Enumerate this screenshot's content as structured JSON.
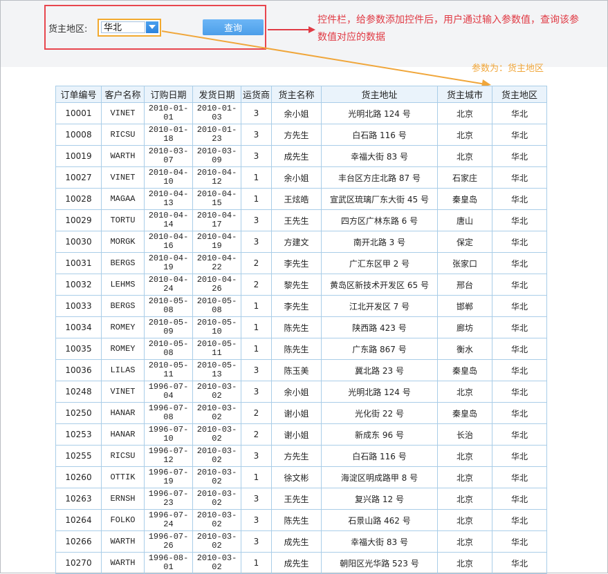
{
  "param_bar": {
    "label": "货主地区:",
    "value": "华北",
    "query_label": "查询"
  },
  "annotations": {
    "control_bar_note": "控件栏，给参数添加控件后，用户通过输入参数值，查询该参数值对应的数据",
    "param_note": "参数为：货主地区"
  },
  "colors": {
    "red_annotation": "#e03a44",
    "orange_annotation": "#f0a63a",
    "button_blue": "#4c9ee9"
  },
  "table": {
    "headers": [
      "订单编号",
      "客户名称",
      "订购日期",
      "发货日期",
      "运货商",
      "货主名称",
      "货主地址",
      "货主城市",
      "货主地区"
    ],
    "rows": [
      [
        "10001",
        "VINET",
        "2010-01-01",
        "2010-01-03",
        "3",
        "余小姐",
        "光明北路 124 号",
        "北京",
        "华北"
      ],
      [
        "10008",
        "RICSU",
        "2010-01-18",
        "2010-01-23",
        "3",
        "方先生",
        "白石路 116 号",
        "北京",
        "华北"
      ],
      [
        "10019",
        "WARTH",
        "2010-03-07",
        "2010-03-09",
        "3",
        "成先生",
        "幸福大街 83 号",
        "北京",
        "华北"
      ],
      [
        "10027",
        "VINET",
        "2010-04-10",
        "2010-04-12",
        "1",
        "余小姐",
        "丰台区方庄北路 87 号",
        "石家庄",
        "华北"
      ],
      [
        "10028",
        "MAGAA",
        "2010-04-13",
        "2010-04-15",
        "1",
        "王炫皓",
        "宣武区琉璃厂东大街 45 号",
        "秦皇岛",
        "华北"
      ],
      [
        "10029",
        "TORTU",
        "2010-04-14",
        "2010-04-17",
        "3",
        "王先生",
        "四方区广林东路 6 号",
        "唐山",
        "华北"
      ],
      [
        "10030",
        "MORGK",
        "2010-04-16",
        "2010-04-19",
        "3",
        "方建文",
        "南开北路 3 号",
        "保定",
        "华北"
      ],
      [
        "10031",
        "BERGS",
        "2010-04-19",
        "2010-04-22",
        "2",
        "李先生",
        "广汇东区甲 2 号",
        "张家口",
        "华北"
      ],
      [
        "10032",
        "LEHMS",
        "2010-04-24",
        "2010-04-26",
        "2",
        "黎先生",
        "黄岛区新技术开发区 65 号",
        "邢台",
        "华北"
      ],
      [
        "10033",
        "BERGS",
        "2010-05-08",
        "2010-05-08",
        "1",
        "李先生",
        "江北开发区 7 号",
        "邯郸",
        "华北"
      ],
      [
        "10034",
        "ROMEY",
        "2010-05-09",
        "2010-05-10",
        "1",
        "陈先生",
        "陕西路 423 号",
        "廊坊",
        "华北"
      ],
      [
        "10035",
        "ROMEY",
        "2010-05-08",
        "2010-05-11",
        "1",
        "陈先生",
        "广东路 867 号",
        "衡水",
        "华北"
      ],
      [
        "10036",
        "LILAS",
        "2010-05-11",
        "2010-05-13",
        "3",
        "陈玉美",
        "冀北路 23 号",
        "秦皇岛",
        "华北"
      ],
      [
        "10248",
        "VINET",
        "1996-07-04",
        "2010-03-02",
        "3",
        "余小姐",
        "光明北路 124 号",
        "北京",
        "华北"
      ],
      [
        "10250",
        "HANAR",
        "1996-07-08",
        "2010-03-02",
        "2",
        "谢小姐",
        "光化街 22 号",
        "秦皇岛",
        "华北"
      ],
      [
        "10253",
        "HANAR",
        "1996-07-10",
        "2010-03-02",
        "2",
        "谢小姐",
        "新成东 96 号",
        "长治",
        "华北"
      ],
      [
        "10255",
        "RICSU",
        "1996-07-12",
        "2010-03-02",
        "3",
        "方先生",
        "白石路 116 号",
        "北京",
        "华北"
      ],
      [
        "10260",
        "OTTIK",
        "1996-07-19",
        "2010-03-02",
        "1",
        "徐文彬",
        "海淀区明成路甲 8 号",
        "北京",
        "华北"
      ],
      [
        "10263",
        "ERNSH",
        "1996-07-23",
        "2010-03-02",
        "3",
        "王先生",
        "复兴路 12 号",
        "北京",
        "华北"
      ],
      [
        "10264",
        "FOLKO",
        "1996-07-24",
        "2010-03-02",
        "3",
        "陈先生",
        "石景山路 462 号",
        "北京",
        "华北"
      ],
      [
        "10266",
        "WARTH",
        "1996-07-26",
        "2010-03-02",
        "3",
        "成先生",
        "幸福大街 83 号",
        "北京",
        "华北"
      ],
      [
        "10270",
        "WARTH",
        "1996-08-01",
        "2010-03-02",
        "1",
        "成先生",
        "朝阳区光华路 523 号",
        "北京",
        "华北"
      ]
    ]
  }
}
